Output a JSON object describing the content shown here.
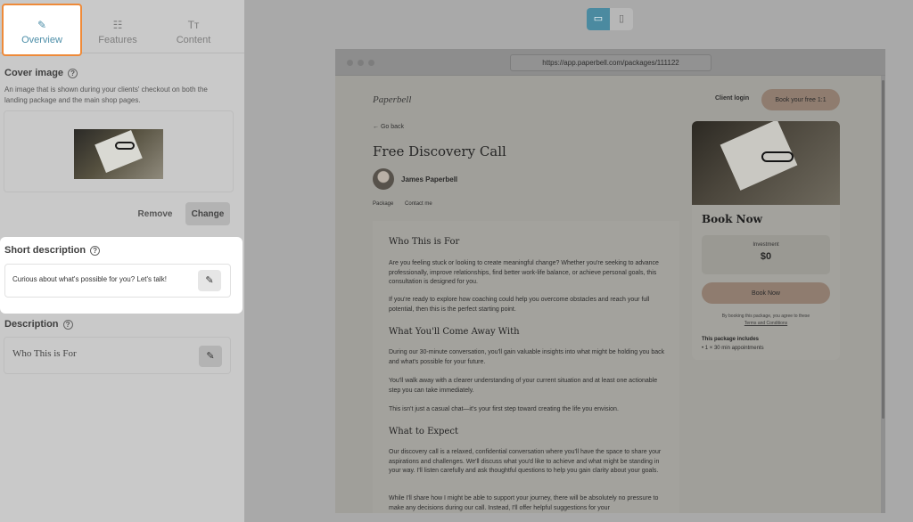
{
  "tabs": {
    "overview": "Overview",
    "features": "Features",
    "content": "Content"
  },
  "cover": {
    "title": "Cover image",
    "description": "An image that is shown during your clients' checkout on both the landing package and the main shop pages.",
    "remove_label": "Remove",
    "change_label": "Change"
  },
  "short_description": {
    "title": "Short description",
    "value": "Curious about what's possible for you? Let's talk!"
  },
  "description": {
    "title": "Description",
    "value": "Who This is For"
  },
  "browser": {
    "url": "https://app.paperbell.com/packages/111122"
  },
  "preview": {
    "logo": "Paperbell",
    "client_login": "Client login",
    "book_top": "Book your free 1:1",
    "go_back": "← Go back",
    "title": "Free Discovery Call",
    "author": "James Paperbell",
    "links": [
      "Package",
      "Contact me"
    ],
    "sections": [
      {
        "heading": "Who This is For",
        "paragraphs": [
          "Are you feeling stuck or looking to create meaningful change? Whether you're seeking to advance professionally, improve relationships, find better work-life balance, or achieve personal goals, this consultation is designed for you.",
          "If you're ready to explore how coaching could help you overcome obstacles and reach your full potential, then this is the perfect starting point."
        ]
      },
      {
        "heading": "What You'll Come Away With",
        "paragraphs": [
          "During our 30-minute conversation, you'll gain valuable insights into what might be holding you back and what's possible for your future.",
          "You'll walk away with a clearer understanding of your current situation and at least one actionable step you can take immediately.",
          "This isn't just a casual chat—it's your first step toward creating the life you envision."
        ]
      },
      {
        "heading": "What to Expect",
        "paragraphs": [
          "Our discovery call is a relaxed, confidential conversation where you'll have the space to share your aspirations and challenges. We'll discuss what you'd like to achieve and what might be standing in your way. I'll listen carefully and ask thoughtful questions to help you gain clarity about your goals.",
          "While I'll share how I might be able to support your journey, there will be absolutely no pressure to make any decisions during our call. Instead, I'll offer helpful suggestions for your"
        ]
      }
    ],
    "card": {
      "title": "Book Now",
      "investment_label": "Investment",
      "investment_value": "$0",
      "book_button": "Book Now",
      "agree_text": "By booking this package, you agree to these",
      "terms": "Terms and Conditions",
      "includes_title": "This package includes",
      "includes_item": "• 1 × 30 min appointments"
    }
  },
  "colors": {
    "accent": "#4c8ea8",
    "highlight": "#ee8a39",
    "button_tan": "#8f7c6f"
  },
  "icons": [
    "pencil-icon",
    "list-icon",
    "text-size-icon",
    "help-icon",
    "desktop-icon",
    "mobile-icon"
  ]
}
